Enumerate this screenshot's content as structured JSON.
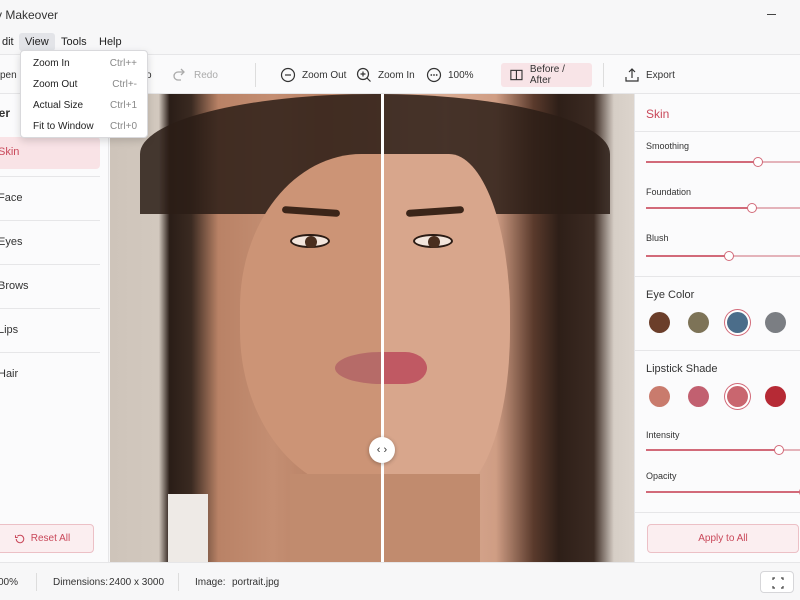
{
  "app": {
    "title": "uty Makeover"
  },
  "menu": {
    "items": [
      "dit",
      "View",
      "Tools",
      "Help"
    ],
    "active": "View"
  },
  "view_menu": {
    "items": [
      {
        "label": "Zoom In",
        "shortcut": "Ctrl++"
      },
      {
        "label": "Zoom Out",
        "shortcut": "Ctrl+-"
      },
      {
        "label": "Actual Size",
        "shortcut": "Ctrl+1"
      },
      {
        "label": "Fit to Window",
        "shortcut": "Ctrl+0"
      }
    ]
  },
  "toolbar": {
    "open_label": "pen",
    "undo_label": "o",
    "redo_label": "Redo",
    "zoom_out_label": "Zoom Out",
    "zoom_in_label": "Zoom In",
    "zoom_level": "100%",
    "before_after_label": "Before / After",
    "export_label": "Export"
  },
  "left_panel": {
    "header": "ver",
    "items": [
      "Skin",
      "Face",
      "Eyes",
      "Brows",
      "Lips",
      "Hair"
    ],
    "active": "Skin",
    "reset_label": "Reset All"
  },
  "right_panel": {
    "skin": {
      "title": "Skin",
      "sliders": [
        {
          "label": "Smoothing",
          "value": 0.7
        },
        {
          "label": "Foundation",
          "value": 0.66
        },
        {
          "label": "Blush",
          "value": 0.52
        }
      ]
    },
    "eye_color": {
      "title": "Eye Color",
      "swatches": [
        "#6b3e2a",
        "#7d7357",
        "#4b6d8a",
        "#7b7e83"
      ],
      "selected_index": 2
    },
    "lipstick": {
      "title": "Lipstick Shade",
      "swatches": [
        "#c97b6d",
        "#c26070",
        "#c9666f",
        "#b62a35"
      ],
      "selected_index": 2,
      "sliders": [
        {
          "label": "Intensity",
          "value": 0.83
        },
        {
          "label": "Opacity",
          "value": 0.99
        }
      ]
    },
    "apply_label": "Apply to All"
  },
  "status": {
    "zoom": "00%",
    "dimensions_label": "Dimensions:",
    "dimensions_value": "2400 x 3000",
    "image_label": "Image:",
    "image_value": "portrait.jpg"
  },
  "colors": {
    "accent": "#d26a79",
    "accent_text": "#c9485a"
  }
}
